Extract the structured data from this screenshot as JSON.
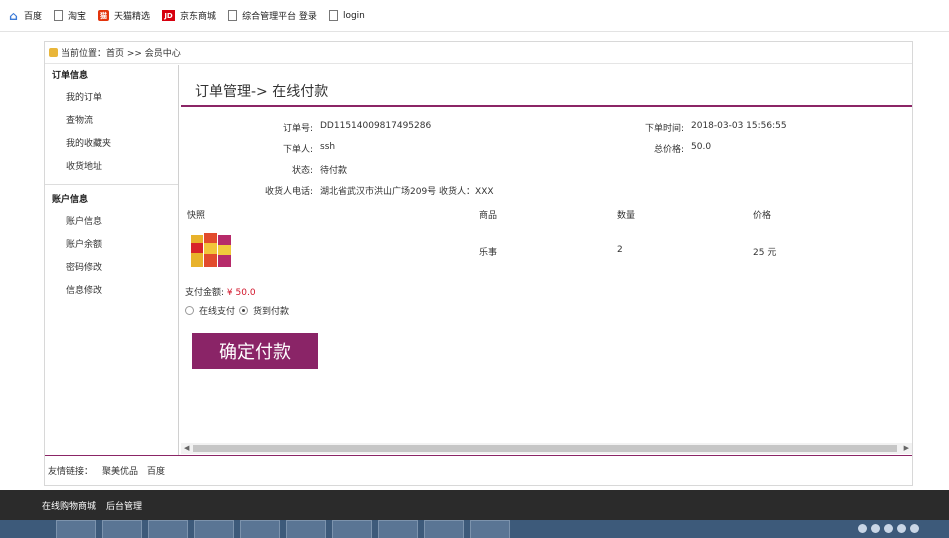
{
  "bookmarks": [
    {
      "label": "百度",
      "icon": "home-icon"
    },
    {
      "label": "淘宝",
      "icon": "page-icon"
    },
    {
      "label": "天猫精选",
      "icon": "tmall-icon"
    },
    {
      "label": "京东商城",
      "icon": "jd-icon"
    },
    {
      "label": "综合管理平台 登录",
      "icon": "page-icon"
    },
    {
      "label": "login",
      "icon": "page-icon"
    }
  ],
  "breadcrumb": "当前位置：首页 >> 会员中心",
  "sidebar": {
    "order_header": "订单信息",
    "order_items": [
      "我的订单",
      "查物流",
      "我的收藏夹",
      "收货地址"
    ],
    "account_header": "账户信息",
    "account_items": [
      "账户信息",
      "账户余额",
      "密码修改",
      "信息修改"
    ]
  },
  "page_title": "订单管理-> 在线付款",
  "order": {
    "order_no_label": "订单号:",
    "order_no": "DD11514009817495286",
    "orderer_label": "下单人:",
    "orderer": "ssh",
    "status_label": "状态:",
    "status": "待付款",
    "address_label": "收货人电话:",
    "address": "湖北省武汉市洪山广场209号 收货人：XXX",
    "time_label": "下单时间:",
    "time": "2018-03-03 15:56:55",
    "total_label": "总价格:",
    "total": "50.0"
  },
  "table": {
    "headers": [
      "快照",
      "商品",
      "数量",
      "价格"
    ],
    "rows": [
      {
        "product": "乐事",
        "qty": "2",
        "price": "25 元"
      }
    ]
  },
  "pay": {
    "amount_label": "支付金额:",
    "amount": "¥ 50.0",
    "online_label": "在线支付",
    "cod_label": "货到付款",
    "selected": "cod",
    "confirm_label": "确定付款"
  },
  "friend_links": {
    "label": "友情链接：",
    "links": [
      "聚美优品",
      "百度"
    ]
  },
  "footer": {
    "links": [
      "在线购物商城",
      "后台管理"
    ]
  },
  "colors": {
    "accent": "#8a2467",
    "price_red": "#d2142a",
    "footer_bg": "#2b2b2b"
  }
}
